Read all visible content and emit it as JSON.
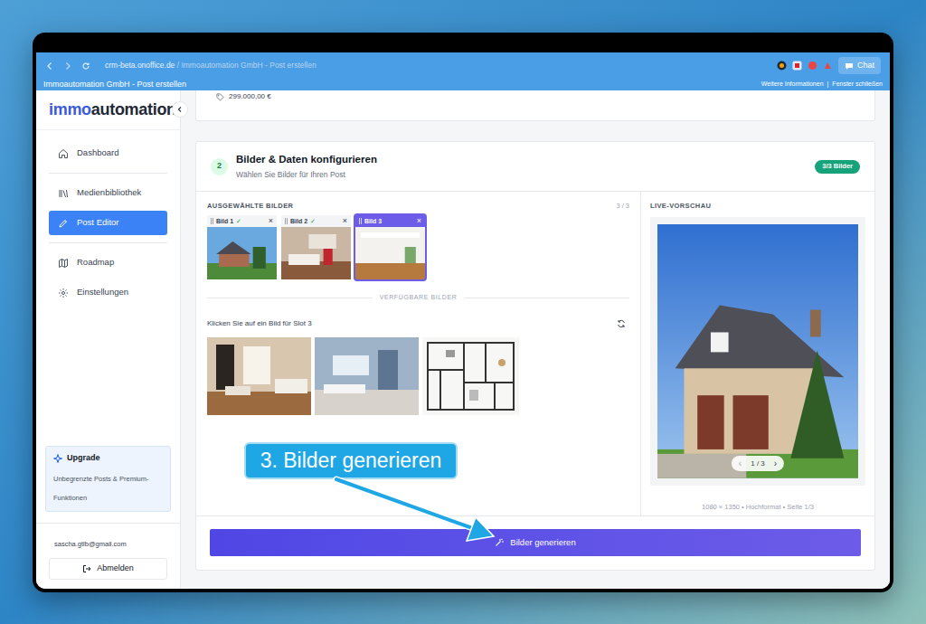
{
  "window": {
    "title": "Immoautomation GmbH - Post erstellen",
    "links": [
      "Weitere Informationen",
      "Fenster schließen"
    ],
    "separator": "|"
  },
  "address_bar": {
    "host": "crm-beta.onoffice.de",
    "path": " / Immoautomation GmbH - Post erstellen"
  },
  "chat_button": "Chat",
  "sidebar": {
    "logo": {
      "prefix": "immo",
      "suffix": "automation"
    },
    "items": [
      {
        "label": "Dashboard",
        "selected": false
      },
      {
        "label": "Medienbibliothek",
        "selected": false
      },
      {
        "label": "Post Editor",
        "selected": true
      },
      {
        "label": "Roadmap",
        "selected": false
      },
      {
        "label": "Einstellungen",
        "selected": false
      }
    ],
    "upgrade": {
      "title": "Upgrade",
      "text": "Unbegrenzte Posts & Premium-Funktionen"
    },
    "email": "sascha.gtlb@gmail.com",
    "logout": "Abmelden"
  },
  "price": "299.000,00 €",
  "section": {
    "number": "2",
    "title": "Bilder & Daten konfigurieren",
    "subtitle": "Wählen Sie Bilder für Ihren Post",
    "badge": "3/3 Bilder"
  },
  "selected_images": {
    "heading": "AUSGEWÄHLTE BILDER",
    "count": "3 / 3",
    "slots": [
      {
        "label": "Bild 1",
        "check": "✓",
        "selected": false,
        "remove": "×"
      },
      {
        "label": "Bild 2",
        "check": "✓",
        "selected": false,
        "remove": "×"
      },
      {
        "label": "Bild 3",
        "selected": true,
        "remove": "×"
      }
    ]
  },
  "available_images": {
    "heading": "VERFÜGBARE BILDER",
    "hint": "Klicken Sie auf ein Bild für Slot 3",
    "images": [
      {
        "kind": "photo"
      },
      {
        "kind": "photo"
      },
      {
        "kind": "floorplan"
      }
    ]
  },
  "preview": {
    "heading": "LIVE-VORSCHAU",
    "prev": "‹",
    "page": "1 / 3",
    "next": "›",
    "caption": "1080 × 1350 • Hochformat • Seite 1/3"
  },
  "generate_button": "Bilder generieren",
  "callout": "3. Bilder generieren"
}
